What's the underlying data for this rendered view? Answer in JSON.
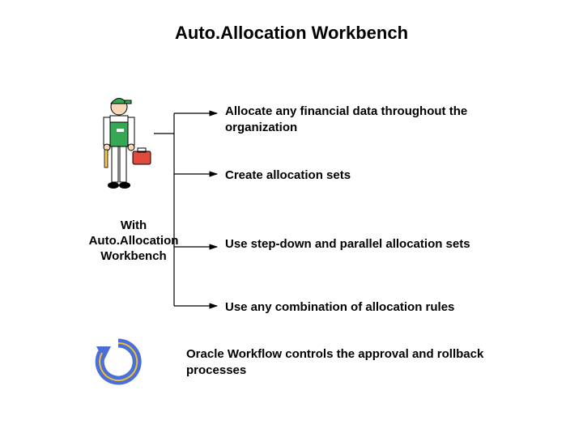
{
  "title": "Auto.Allocation Workbench",
  "caption_line1": "With",
  "caption_line2": "Auto.Allocation",
  "caption_line3": "Workbench",
  "bullets": {
    "b1": "Allocate any financial data throughout the organization",
    "b2": "Create allocation sets",
    "b3": "Use step-down and parallel allocation sets",
    "b4": "Use any combination of allocation rules"
  },
  "footer": "Oracle Workflow controls the approval and rollback processes"
}
